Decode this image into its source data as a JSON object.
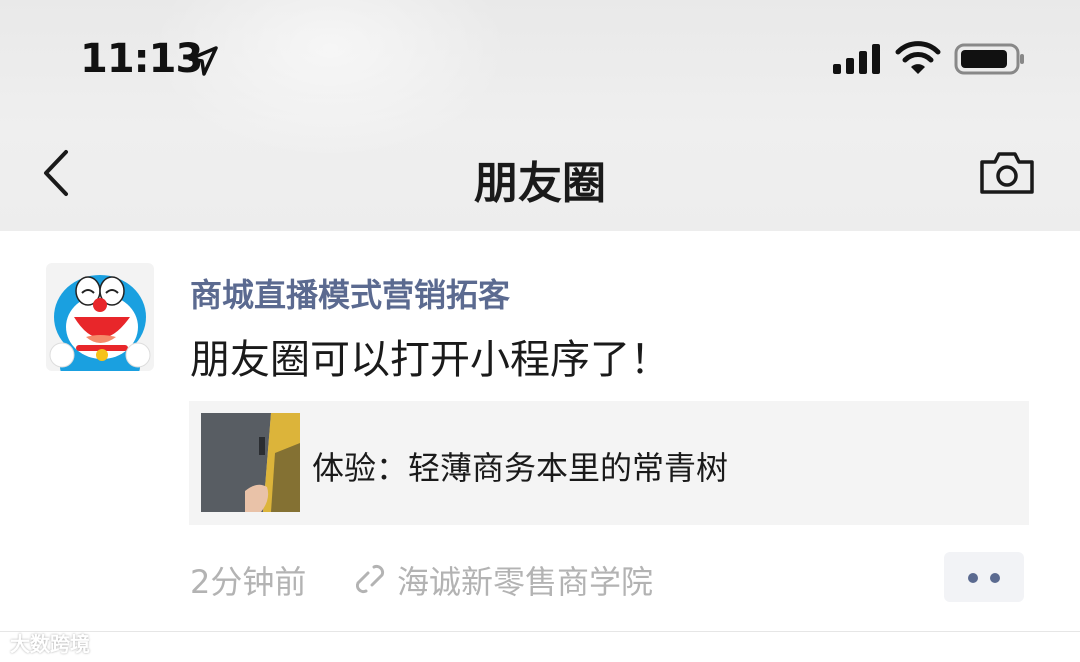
{
  "status_bar": {
    "time": "11:13",
    "icons": [
      "location-arrow-icon",
      "signal-icon",
      "wifi-icon",
      "battery-icon"
    ]
  },
  "nav": {
    "back_icon": "chevron-left-icon",
    "title": "朋友圈",
    "camera_icon": "camera-icon"
  },
  "post": {
    "avatar": "doraemon-avatar",
    "author": "商城直播模式营销拓客",
    "text": "朋友圈可以打开小程序了！",
    "card": {
      "title": "体验：轻薄商务本里的常青树"
    },
    "time": "2分钟前",
    "source": "海诚新零售商学院",
    "more_icon": "more-dots-icon"
  },
  "watermark": "大数跨境",
  "colors": {
    "author": "#5b6a90",
    "meta": "#b3b3b3",
    "card_bg": "#f4f4f4",
    "nav_bg": "#eeeeee"
  }
}
